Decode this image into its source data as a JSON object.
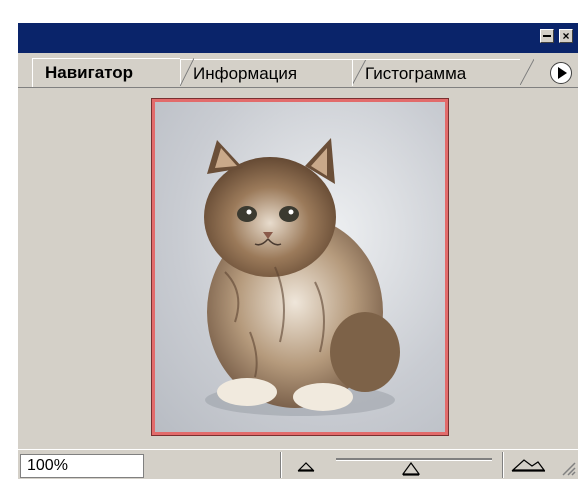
{
  "window": {
    "minimize_glyph": "",
    "close_glyph": "×"
  },
  "tabs": [
    {
      "label": "Навигатор",
      "active": true
    },
    {
      "label": "Информация",
      "active": false
    },
    {
      "label": "Гистограмма",
      "active": false
    }
  ],
  "preview": {
    "subject": "kitten"
  },
  "footer": {
    "zoom_value": "100%",
    "zoom_level": 1.0,
    "slider_level": 0.45
  },
  "colors": {
    "title_bar": "#0a246a",
    "panel_bg": "#d4d0c8",
    "view_box": "#e26b6b"
  },
  "icons": [
    "panel-menu-icon",
    "zoom-out-icon",
    "zoom-in-icon",
    "resize-grip-icon"
  ]
}
